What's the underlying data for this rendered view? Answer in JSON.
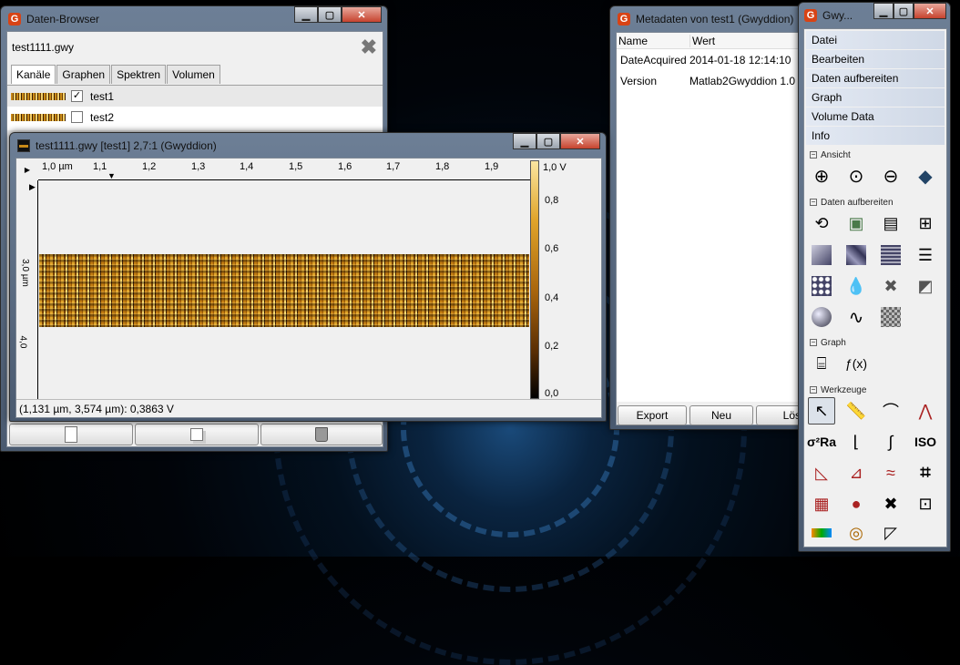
{
  "databrowser": {
    "title": "Daten-Browser",
    "filename": "test1111.gwy",
    "tabs": [
      "Kanäle",
      "Graphen",
      "Spektren",
      "Volumen"
    ],
    "channels": [
      {
        "label": "test1",
        "checked": true
      },
      {
        "label": "test2",
        "checked": false
      }
    ]
  },
  "dataview": {
    "title": "test1111.gwy [test1] 2,7:1 (Gwyddion)",
    "xticks": [
      "1,0 µm",
      "1,1",
      "1,2",
      "1,3",
      "1,4",
      "1,5",
      "1,6",
      "1,7",
      "1,8",
      "1,9"
    ],
    "yticks": [
      "3,0 µm",
      "4,0"
    ],
    "colorbar": [
      "1,0 V",
      "0,8",
      "0,6",
      "0,4",
      "0,2",
      "0,0"
    ],
    "status": "(1,131 µm, 3,574 µm): 0,3863 V"
  },
  "metadata": {
    "title": "Metadaten von test1 (Gwyddion)",
    "headers": [
      "Name",
      "Wert"
    ],
    "rows": [
      {
        "name": "DateAcquired",
        "value": "2014-01-18 12:14:10"
      },
      {
        "name": "Version",
        "value": "Matlab2Gwyddion 1.0"
      }
    ],
    "buttons": [
      "Export",
      "Neu",
      "Lösc"
    ]
  },
  "toolbox": {
    "title": "Gwy...",
    "menu": [
      "Datei",
      "Bearbeiten",
      "Daten aufbereiten",
      "Graph",
      "Volume Data",
      "Info"
    ],
    "sections": [
      "Ansicht",
      "Daten aufbereiten",
      "Graph",
      "Werkzeuge"
    ],
    "iso_label": "ISO"
  }
}
